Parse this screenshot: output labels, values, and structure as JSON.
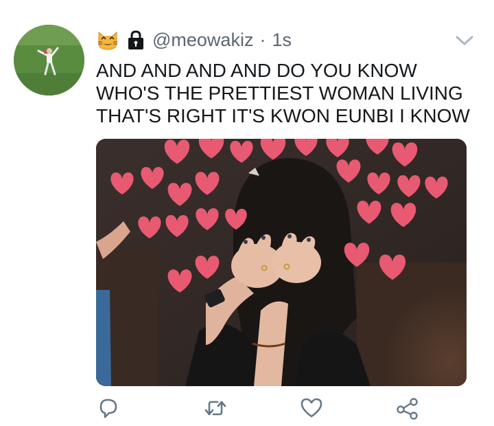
{
  "tweet": {
    "avatar_icon": "user-avatar",
    "emoji_icon": "cat-face-emoji",
    "lock_icon": "lock-icon",
    "handle": "@meowakiz",
    "separator": "·",
    "time": "1s",
    "more_icon": "chevron-down-icon",
    "text_lines": [
      "AND AND AND AND DO YOU KNOW",
      "WHO'S THE PRETTIEST WOMAN LIVING",
      "THAT'S RIGHT IT'S KWON EUNBI I KNOW"
    ],
    "media_description_icon": "photo-with-hearts",
    "heart_color": "#e85a71"
  },
  "actions": [
    {
      "icon": "reply-icon"
    },
    {
      "icon": "retweet-icon"
    },
    {
      "icon": "like-icon"
    },
    {
      "icon": "share-icon"
    }
  ],
  "colors": {
    "secondary_text": "#5b6673",
    "icon_gray": "#657786",
    "chevron_gray": "#aab8c2"
  }
}
